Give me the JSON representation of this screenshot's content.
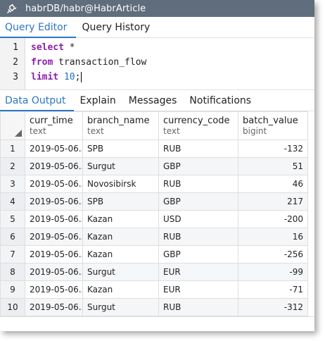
{
  "titlebar": {
    "icon": "plug-icon",
    "title": "habrDB/habr@HabrArticle"
  },
  "editor_tabs": [
    {
      "label": "Query Editor",
      "active": true
    },
    {
      "label": "Query History",
      "active": false
    }
  ],
  "editor": {
    "line_numbers": [
      "1",
      "2",
      "3"
    ],
    "lines": [
      {
        "kw": "select",
        "rest": " *"
      },
      {
        "kw": "from",
        "rest": " transaction_flow"
      },
      {
        "kw": "limit",
        "num": "10",
        "rest": ";"
      }
    ]
  },
  "result_tabs": [
    {
      "label": "Data Output",
      "active": true
    },
    {
      "label": "Explain",
      "active": false
    },
    {
      "label": "Messages",
      "active": false
    },
    {
      "label": "Notifications",
      "active": false
    }
  ],
  "columns": [
    {
      "name": "curr_time",
      "type": "text"
    },
    {
      "name": "branch_name",
      "type": "text"
    },
    {
      "name": "currency_code",
      "type": "text"
    },
    {
      "name": "batch_value",
      "type": "bigint"
    }
  ],
  "rows": [
    {
      "n": "1",
      "curr_time": "2019-05-06...",
      "branch_name": "SPB",
      "currency_code": "RUB",
      "batch_value": "-132"
    },
    {
      "n": "2",
      "curr_time": "2019-05-06...",
      "branch_name": "Surgut",
      "currency_code": "GBP",
      "batch_value": "51"
    },
    {
      "n": "3",
      "curr_time": "2019-05-06...",
      "branch_name": "Novosibirsk",
      "currency_code": "RUB",
      "batch_value": "46"
    },
    {
      "n": "4",
      "curr_time": "2019-05-06...",
      "branch_name": "SPB",
      "currency_code": "GBP",
      "batch_value": "217"
    },
    {
      "n": "5",
      "curr_time": "2019-05-06...",
      "branch_name": "Kazan",
      "currency_code": "USD",
      "batch_value": "-200"
    },
    {
      "n": "6",
      "curr_time": "2019-05-06...",
      "branch_name": "Kazan",
      "currency_code": "RUB",
      "batch_value": "16"
    },
    {
      "n": "7",
      "curr_time": "2019-05-06...",
      "branch_name": "Kazan",
      "currency_code": "GBP",
      "batch_value": "-256"
    },
    {
      "n": "8",
      "curr_time": "2019-05-06...",
      "branch_name": "Surgut",
      "currency_code": "EUR",
      "batch_value": "-99"
    },
    {
      "n": "9",
      "curr_time": "2019-05-06...",
      "branch_name": "Kazan",
      "currency_code": "EUR",
      "batch_value": "-71"
    },
    {
      "n": "10",
      "curr_time": "2019-05-06...",
      "branch_name": "Surgut",
      "currency_code": "RUB",
      "batch_value": "-312"
    }
  ],
  "colors": {
    "titlebar_bg": "#5f6d7c",
    "active_tab": "#2c76c7",
    "keyword": "#8b1ea8",
    "number": "#1f6fbf"
  }
}
